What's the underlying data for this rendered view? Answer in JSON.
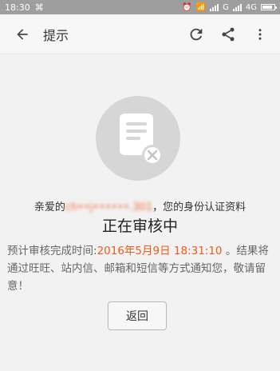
{
  "status_bar": {
    "time": "18:30",
    "network_1": "G",
    "network_2": "4G",
    "battery_percent": 85
  },
  "appbar": {
    "title": "提示",
    "icons": [
      "back-arrow-icon",
      "refresh-icon",
      "share-icon",
      "more-vert-icon"
    ]
  },
  "main": {
    "hero_icon": "document-rejected-icon",
    "line1_prefix": "亲爱的",
    "line1_name": "ch••j••••••.301",
    "line1_suffix": "，您的身份认证资料",
    "status_title": "正在审核中",
    "desc_prefix": "预计审核完成时间:",
    "desc_time": "2016年5月9日 18:31:10",
    "desc_suffix": " 。结果将通过旺旺、站内信、邮箱和短信等方式通知您，敬请留意！",
    "back_button": "返回"
  },
  "colors": {
    "accent_orange": "#f05a1b",
    "hero_circle": "#d6d6d6",
    "statusbar": "#9e9e9e"
  }
}
